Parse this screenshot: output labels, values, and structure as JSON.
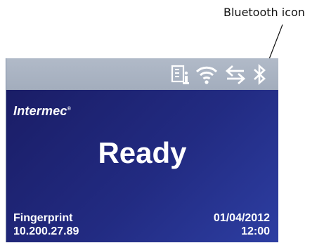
{
  "callout": {
    "label": "Bluetooth icon"
  },
  "status_bar": {
    "icons": [
      "info-icon",
      "wifi-icon",
      "transfer-arrows-icon",
      "bluetooth-icon"
    ]
  },
  "screen": {
    "brand": "Intermec",
    "status": "Ready",
    "app_name": "Fingerprint",
    "ip_address": "10.200.27.89",
    "date": "01/04/2012",
    "time": "12:00"
  },
  "colors": {
    "status_bar": "#a9b2c2",
    "background_dark": "#1a1d66",
    "background_light": "#2d3ea2",
    "text": "#ffffff"
  }
}
